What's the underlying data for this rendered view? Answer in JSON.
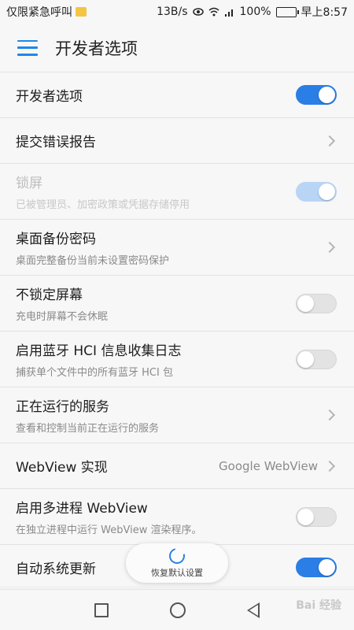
{
  "status_bar": {
    "carrier_text": "仅限紧急呼叫",
    "speed": "13B/s",
    "battery_percent": "100%",
    "time": "早上8:57"
  },
  "app_bar": {
    "title": "开发者选项"
  },
  "settings": [
    {
      "title": "开发者选项",
      "subtitle": "",
      "control": "toggle",
      "state": "on",
      "enabled": true
    },
    {
      "title": "提交错误报告",
      "subtitle": "",
      "control": "chevron",
      "enabled": true
    },
    {
      "title": "锁屏",
      "subtitle": "已被管理员、加密政策或凭据存储停用",
      "control": "toggle",
      "state": "on",
      "enabled": false
    },
    {
      "title": "桌面备份密码",
      "subtitle": "桌面完整备份当前未设置密码保护",
      "control": "chevron",
      "enabled": true
    },
    {
      "title": "不锁定屏幕",
      "subtitle": "充电时屏幕不会休眠",
      "control": "toggle",
      "state": "off",
      "enabled": true
    },
    {
      "title": "启用蓝牙 HCI 信息收集日志",
      "subtitle": "捕获单个文件中的所有蓝牙 HCI 包",
      "control": "toggle",
      "state": "off",
      "enabled": true
    },
    {
      "title": "正在运行的服务",
      "subtitle": "查看和控制当前正在运行的服务",
      "control": "chevron",
      "enabled": true
    },
    {
      "title": "WebView 实现",
      "subtitle": "",
      "value": "Google WebView",
      "control": "chevron",
      "enabled": true
    },
    {
      "title": "启用多进程 WebView",
      "subtitle": "在独立进程中运行 WebView 渲染程序。",
      "control": "toggle",
      "state": "off",
      "enabled": true
    },
    {
      "title": "自动系统更新",
      "subtitle": "",
      "control": "toggle",
      "state": "on",
      "enabled": true
    }
  ],
  "reset_button": {
    "label": "恢复默认设置"
  },
  "watermark": "Bai 经验",
  "colors": {
    "accent": "#2a7ee6",
    "toggle_off": "#e3e3e3",
    "background": "#f7f7f7"
  },
  "icons": [
    "menu-icon",
    "wifi-icon",
    "eye-icon",
    "signal-icon",
    "battery-icon",
    "refresh-icon",
    "recent-apps-icon",
    "home-icon",
    "back-icon"
  ]
}
